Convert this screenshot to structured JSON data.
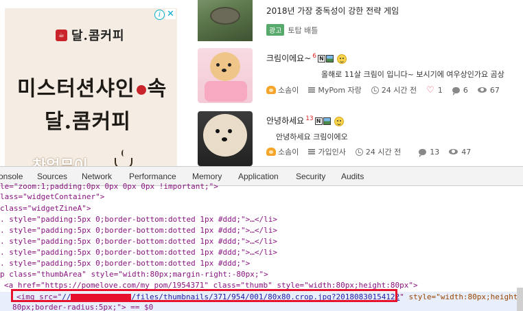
{
  "ad": {
    "brand_small": "달.콤커피",
    "headline_part1": "미스터션샤인",
    "headline_part2": "속",
    "brand_large": "달.콤커피",
    "bottom_text": "찬얼무이",
    "info_icon": "i",
    "close_icon": "✕"
  },
  "posts": [
    {
      "title": "2018년 가장 중독성이 강한 전략 게임",
      "ad_label": "광고",
      "sponsor": "토탑 배틀"
    },
    {
      "title": "크림이에요~",
      "comment_count": "6",
      "badge_n": "N",
      "excerpt": "올해로 11살 크림이 입니다~ 보시기에 여우상인가요 곰상",
      "author": "소솜이",
      "category": "MyPom 자랑",
      "time": "24 시간 전",
      "likes": "1",
      "comments": "6",
      "views": "67"
    },
    {
      "title": "안녕하세요",
      "comment_count": "13",
      "badge_n": "N",
      "excerpt": "안녕하세요 크림이에오",
      "author": "소솜이",
      "category": "가입인사",
      "time": "24 시간 전",
      "comments": "13",
      "views": "47"
    }
  ],
  "devtools": {
    "tabs": [
      "onsole",
      "Sources",
      "Network",
      "Performance",
      "Memory",
      "Application",
      "Security",
      "Audits"
    ],
    "lines": [
      "le=\"zoom:1;padding:0px 0px 0px 0px !important;\">",
      "lass=\"widgetContainer\">",
      "class=\"widgetZineA\">",
      ". style=\"padding:5px 0;border-bottom:dotted 1px #ddd;\">…</li>",
      ". style=\"padding:5px 0;border-bottom:dotted 1px #ddd;\">…</li>",
      ". style=\"padding:5px 0;border-bottom:dotted 1px #ddd;\">…</li>",
      ". style=\"padding:5px 0;border-bottom:dotted 1px #ddd;\">…</li>",
      ". style=\"padding:5px 0;border-bottom:dotted 1px #ddd;\">",
      "p class=\"thumbArea\" style=\"width:80px;margin-right:-80px;\">",
      "<a href=\"https://pomelove.com/my_pom/1954371\" class=\"thumb\" style=\"width:80px;height:80px\">"
    ],
    "img_line": {
      "prefix": "<img src=\"",
      "url_start": "//",
      "url_path": "/files/thumbnails/371/954/001/80x80.crop.jpg?20180830154122",
      "suffix_attr": " style=\"width:80px;height:",
      "next_line": "80px;border-radius:5px;\"> == $0"
    }
  },
  "colors": {
    "accent_red": "#e8112d",
    "ad_green": "#58a96c",
    "tag_purple": "#881280"
  }
}
